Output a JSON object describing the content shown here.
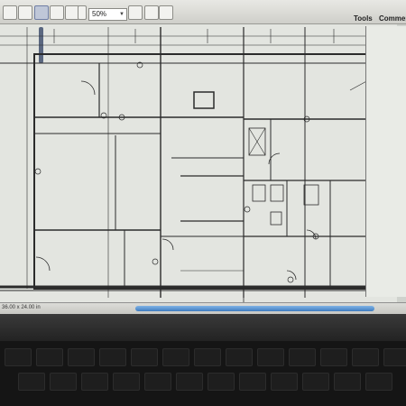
{
  "toolbar": {
    "zoom_value": "50%",
    "tools_label": "Tools",
    "comments_label": "Commen"
  },
  "status": {
    "page_size": "36.00 x 24.00 in"
  },
  "icons": {
    "zoom_dropdown": "chevron-down-icon"
  }
}
